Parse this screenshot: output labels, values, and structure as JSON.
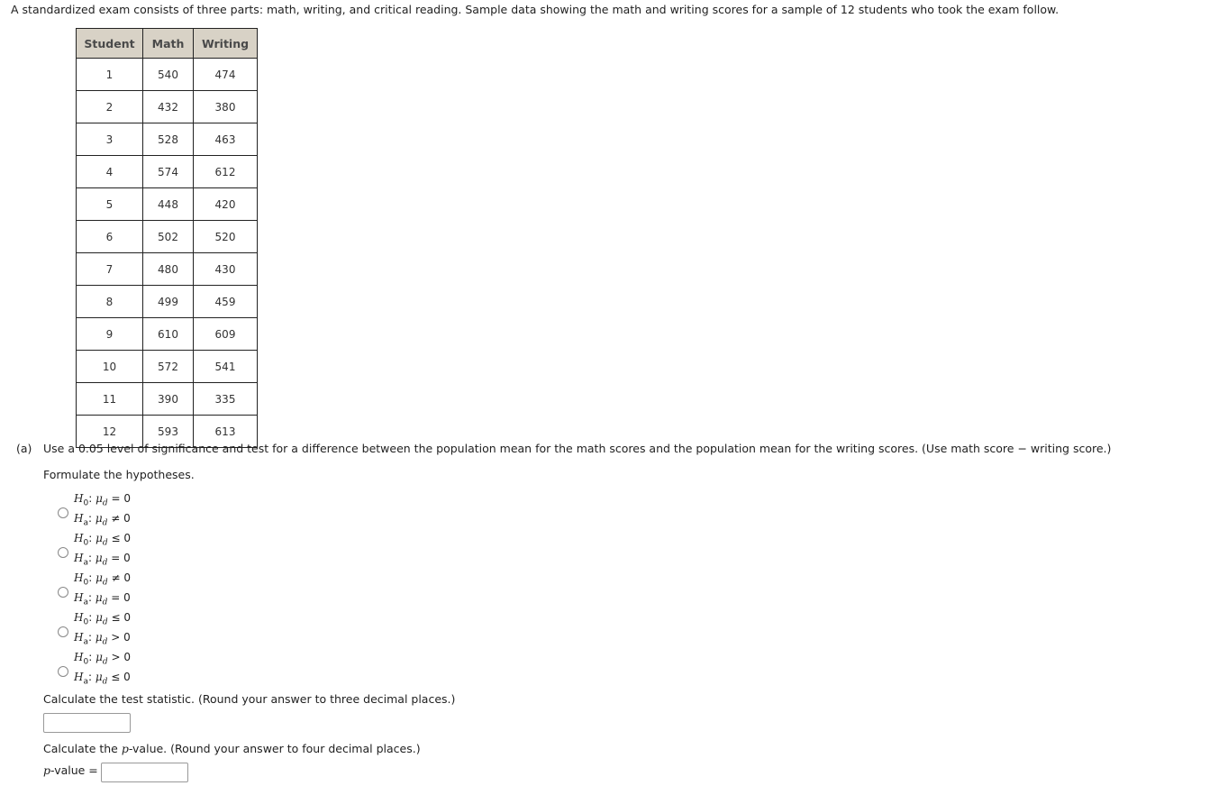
{
  "intro": "A standardized exam consists of three parts: math, writing, and critical reading. Sample data showing the math and writing scores for a sample of 12 students who took the exam follow.",
  "table": {
    "headers": [
      "Student",
      "Math",
      "Writing"
    ],
    "rows": [
      [
        "1",
        "540",
        "474"
      ],
      [
        "2",
        "432",
        "380"
      ],
      [
        "3",
        "528",
        "463"
      ],
      [
        "4",
        "574",
        "612"
      ],
      [
        "5",
        "448",
        "420"
      ],
      [
        "6",
        "502",
        "520"
      ],
      [
        "7",
        "480",
        "430"
      ],
      [
        "8",
        "499",
        "459"
      ],
      [
        "9",
        "610",
        "609"
      ],
      [
        "10",
        "572",
        "541"
      ],
      [
        "11",
        "390",
        "335"
      ],
      [
        "12",
        "593",
        "613"
      ]
    ]
  },
  "partA": {
    "label": "(a)",
    "text": "Use a 0.05 level of significance and test for a difference between the population mean for the math scores and the population mean for the writing scores. (Use math score − writing score.)",
    "formulate": "Formulate the hypotheses.",
    "options": [
      {
        "h0_op": "=",
        "ha_op": "≠"
      },
      {
        "h0_op": "≤",
        "ha_op": "="
      },
      {
        "h0_op": "≠",
        "ha_op": "="
      },
      {
        "h0_op": "≤",
        "ha_op": ">"
      },
      {
        "h0_op": ">",
        "ha_op": "≤"
      }
    ],
    "calc_stat": "Calculate the test statistic. (Round your answer to three decimal places.)",
    "test_stat_value": "",
    "calc_p_prefix": "Calculate the ",
    "calc_p_italic": "p",
    "calc_p_suffix": "-value. (Round your answer to four decimal places.)",
    "pvalue_label_italic": "p",
    "pvalue_label_suffix": "-value =",
    "pvalue_value": ""
  }
}
